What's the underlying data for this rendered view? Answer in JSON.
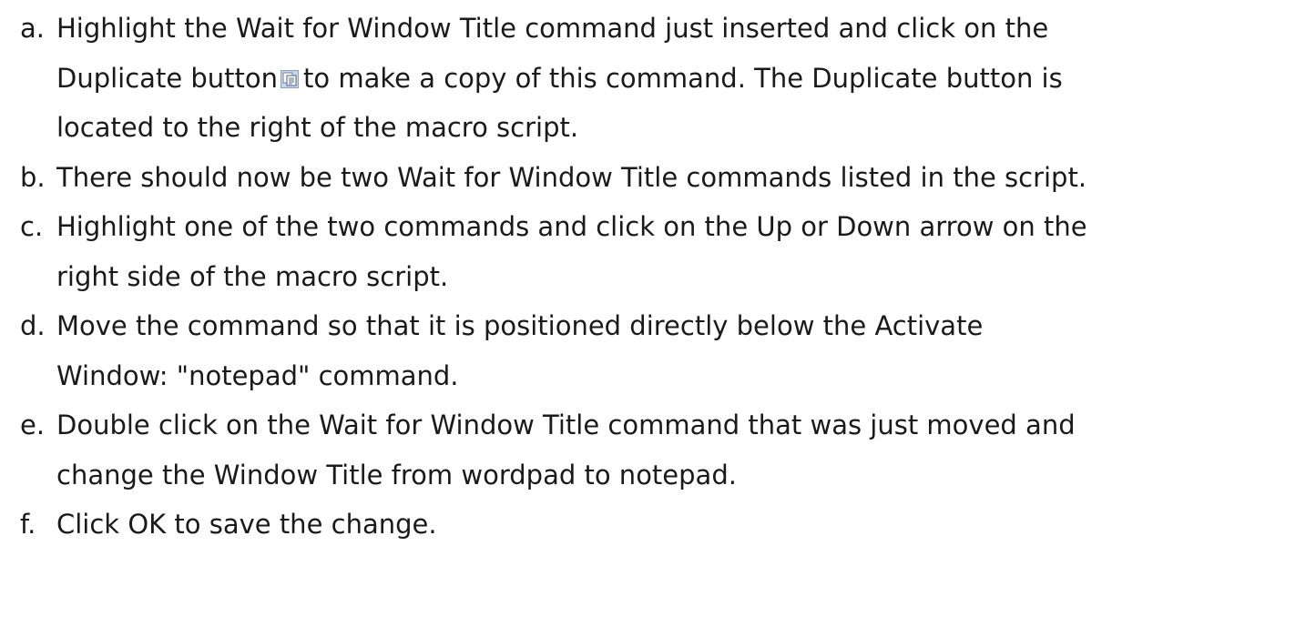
{
  "steps": [
    {
      "label": "a.",
      "line1": "Highlight the Wait for Window Title command just inserted and click on the",
      "line2_before": "Duplicate button",
      "icon": "duplicate-icon",
      "line2_after": "to make a copy of this command. The Duplicate button is",
      "line3": "located to the right of the macro script."
    },
    {
      "label": "b.",
      "line1": "There should now be two Wait for Window Title commands listed in the script."
    },
    {
      "label": "c.",
      "line1": "Highlight one of the two commands and click on the Up or Down arrow on the",
      "line2": "right side of the macro script."
    },
    {
      "label": "d.",
      "line1": "Move the command so that it is positioned directly below the Activate",
      "line2": "Window: \"notepad\" command."
    },
    {
      "label": "e.",
      "line1": "Double click on the Wait for Window Title command that was just moved and",
      "line2": "change the Window Title from wordpad to notepad."
    },
    {
      "label": "f.",
      "line1": "Click OK to save the change."
    }
  ]
}
